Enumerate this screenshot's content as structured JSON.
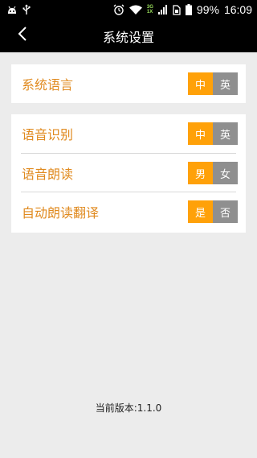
{
  "statusbar": {
    "network_top": "3G",
    "network_bottom": "1X",
    "battery": "99%",
    "time": "16:09"
  },
  "header": {
    "title": "系统设置"
  },
  "settings": {
    "language": {
      "label": "系统语言",
      "options": [
        "中",
        "英"
      ],
      "selected": "中"
    },
    "speech_recognition": {
      "label": "语音识别",
      "options": [
        "中",
        "英"
      ],
      "selected": "中"
    },
    "speech_reading": {
      "label": "语音朗读",
      "options": [
        "男",
        "女"
      ],
      "selected": "男"
    },
    "auto_read_translation": {
      "label": "自动朗读翻译",
      "options": [
        "是",
        "否"
      ],
      "selected": "是"
    }
  },
  "footer": {
    "version": "当前版本:1.1.0"
  },
  "colors": {
    "accent": "#ffa109",
    "label": "#e08a1f",
    "off": "#8f8f8f",
    "bar": "#000000",
    "background": "#ececec"
  }
}
